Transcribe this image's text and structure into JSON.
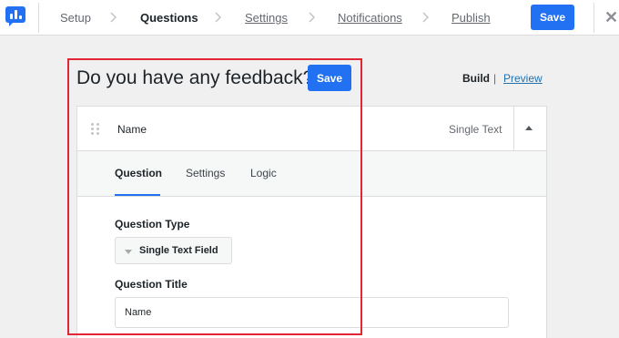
{
  "topbar": {
    "steps": [
      {
        "label": "Setup"
      },
      {
        "label": "Questions"
      },
      {
        "label": "Settings"
      },
      {
        "label": "Notifications"
      },
      {
        "label": "Publish"
      }
    ],
    "active_step": "Questions",
    "save_label": "Save",
    "close_icon": "close-icon",
    "logo_icon": "chart-logo-icon",
    "accent_color": "#2271f3"
  },
  "form": {
    "title": "Do you have any feedback?",
    "save_label": "Save",
    "view": {
      "build": "Build",
      "separator": "|",
      "preview": "Preview"
    }
  },
  "question": {
    "name": "Name",
    "type": "Single Text",
    "tabs": [
      "Question",
      "Settings",
      "Logic"
    ],
    "active_tab": "Question",
    "question_type_label": "Question Type",
    "question_type_value": "Single Text Field",
    "question_title_label": "Question Title",
    "question_title_value": "Name"
  },
  "annotation": {
    "highlight_color": "#e32636"
  }
}
